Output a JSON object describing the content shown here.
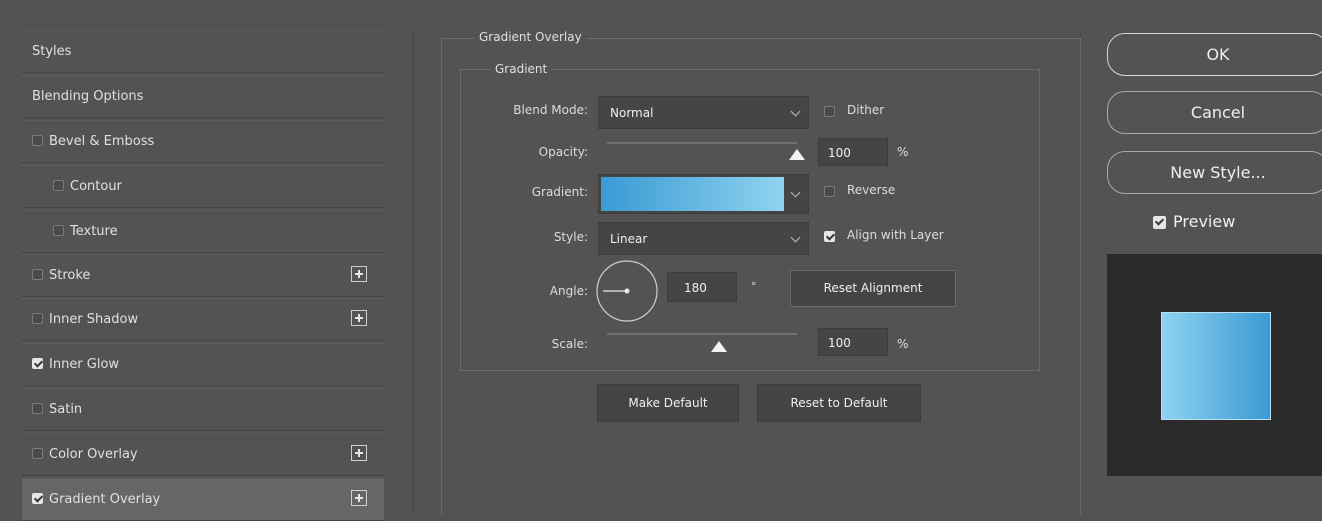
{
  "styles_list": {
    "header": "Styles",
    "blending_options": "Blending Options",
    "items": [
      {
        "label": "Bevel & Emboss",
        "checked": false,
        "plus": false,
        "indent": false
      },
      {
        "label": "Contour",
        "checked": false,
        "plus": false,
        "indent": true
      },
      {
        "label": "Texture",
        "checked": false,
        "plus": false,
        "indent": true
      },
      {
        "label": "Stroke",
        "checked": false,
        "plus": true,
        "indent": false
      },
      {
        "label": "Inner Shadow",
        "checked": false,
        "plus": true,
        "indent": false
      },
      {
        "label": "Inner Glow",
        "checked": true,
        "plus": false,
        "indent": false
      },
      {
        "label": "Satin",
        "checked": false,
        "plus": false,
        "indent": false
      },
      {
        "label": "Color Overlay",
        "checked": false,
        "plus": true,
        "indent": false
      },
      {
        "label": "Gradient Overlay",
        "checked": true,
        "plus": true,
        "indent": false,
        "selected": true
      }
    ]
  },
  "gradient_overlay": {
    "section_title": "Gradient Overlay",
    "group_title": "Gradient",
    "blend_mode_label": "Blend Mode:",
    "blend_mode_value": "Normal",
    "dither_label": "Dither",
    "dither_checked": false,
    "opacity_label": "Opacity:",
    "opacity_value": "100",
    "opacity_unit": "%",
    "opacity_fraction": 1.0,
    "gradient_label": "Gradient:",
    "gradient_colors": [
      "#3a9ad4",
      "#8fd3f0"
    ],
    "reverse_label": "Reverse",
    "reverse_checked": false,
    "style_label": "Style:",
    "style_value": "Linear",
    "align_label": "Align with Layer",
    "align_checked": true,
    "angle_label": "Angle:",
    "angle_value": "180",
    "angle_unit": "°",
    "reset_alignment_label": "Reset Alignment",
    "scale_label": "Scale:",
    "scale_value": "100",
    "scale_unit": "%",
    "scale_fraction": 0.5,
    "make_default_label": "Make Default",
    "reset_default_label": "Reset to Default"
  },
  "actions": {
    "ok_label": "OK",
    "cancel_label": "Cancel",
    "new_style_label": "New Style...",
    "preview_label": "Preview",
    "preview_checked": true
  },
  "colors": {
    "background": "#535353",
    "preview_bg": "#2b2b2b",
    "preview_swatch": [
      "#8fd3f0",
      "#3a9ad4"
    ]
  }
}
